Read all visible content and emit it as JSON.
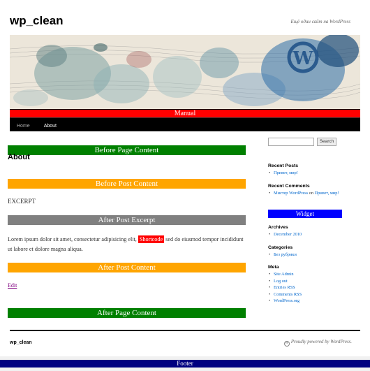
{
  "site": {
    "title": "wp_clean",
    "description": "Ещё один сайт на WordPress"
  },
  "header": {
    "menu_label": "Manual"
  },
  "nav": {
    "items": [
      "Home",
      "About"
    ]
  },
  "content": {
    "before_page": "Before Page Content",
    "post_title": "About",
    "before_post": "Before Post Content",
    "excerpt": "EXCERPT",
    "after_excerpt": "After Post Excerpt",
    "body_before": "Lorem ipsum dolor sit amet, consectetur adipisicing elit, ",
    "shortcode": "Shortcode",
    "body_after": " sed do eiusmod tempor incididunt ut labore et dolore magna aliqua.",
    "after_post": "After Post Content",
    "edit": "Edit",
    "after_page": "After Page Content"
  },
  "sidebar": {
    "search_button": "Search",
    "recent_posts_title": "Recent Posts",
    "recent_posts": [
      "Привет, мир!"
    ],
    "recent_comments_title": "Recent Comments",
    "recent_comment_author": "Мистер WordPress",
    "recent_comment_on": "on",
    "recent_comment_post": "Привет, мир!",
    "widget_label": "Widget",
    "archives_title": "Archives",
    "archives": [
      "December 2010"
    ],
    "categories_title": "Categories",
    "categories": [
      "Без рубрики"
    ],
    "meta_title": "Meta",
    "meta": [
      "Site Admin",
      "Log out",
      "Entries RSS",
      "Comments RSS",
      "WordPress.org"
    ]
  },
  "footer": {
    "title": "wp_clean",
    "credit": "Proudly powered by WordPress.",
    "bar_label": "Footer"
  },
  "colors": {
    "green": "#008000",
    "orange": "#ffa500",
    "gray": "#808080",
    "red": "#ff0000",
    "blue": "#0000ff",
    "navy": "#000080"
  }
}
